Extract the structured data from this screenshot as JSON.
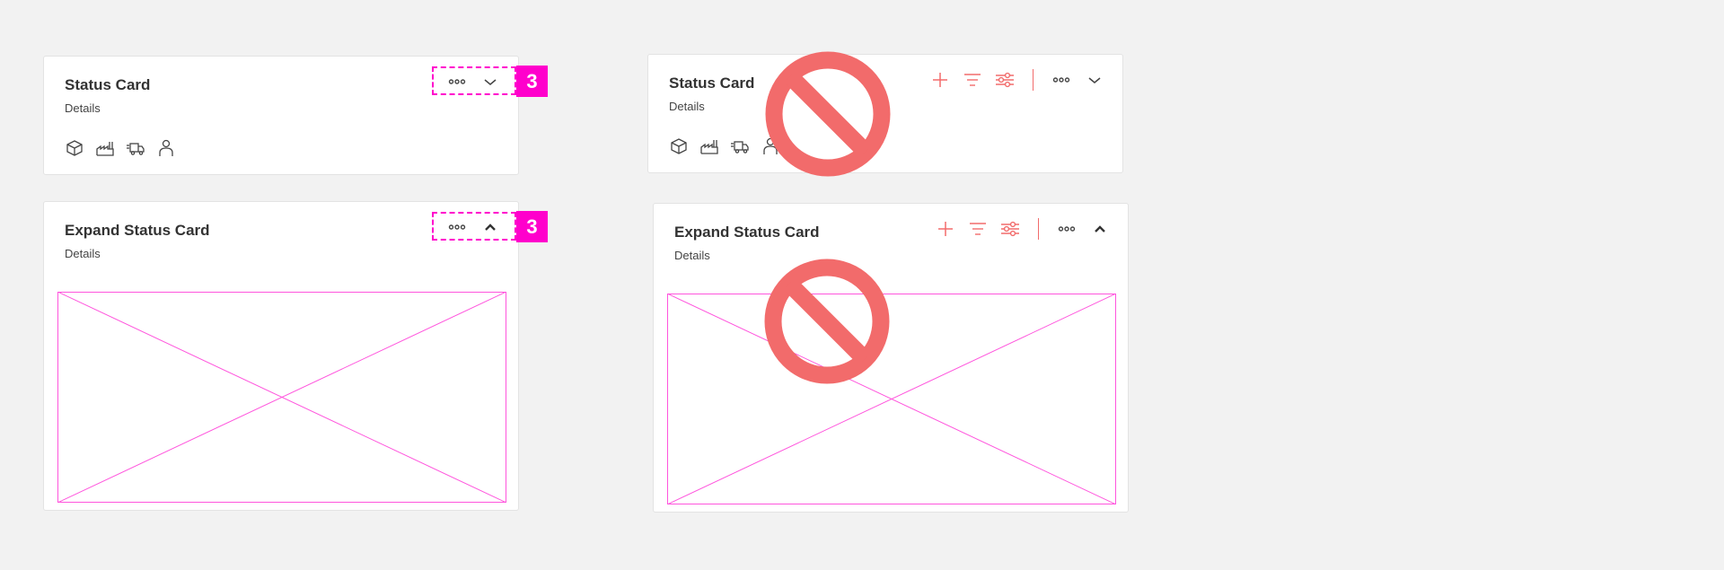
{
  "colors": {
    "background": "#f2f2f2",
    "card": "#ffffff",
    "annotation": "#ff00cc",
    "forbidden": "#f26b6b",
    "icon": "#444444"
  },
  "left_collapsed": {
    "title": "Status Card",
    "subtitle": "Details",
    "badge": "3",
    "actions": [
      "more-icon",
      "chevron-down-icon"
    ],
    "status_icons": [
      "box-icon",
      "factory-icon",
      "truck-icon",
      "person-icon"
    ]
  },
  "left_expanded": {
    "title": "Expand Status Card",
    "subtitle": "Details",
    "badge": "3",
    "actions": [
      "more-icon",
      "chevron-up-icon"
    ]
  },
  "right_collapsed": {
    "title": "Status Card",
    "subtitle": "Details",
    "tools": [
      "plus-icon",
      "filter-icon",
      "settings-sliders-icon"
    ],
    "actions": [
      "more-icon",
      "chevron-down-icon"
    ],
    "status_icons": [
      "box-icon",
      "factory-icon",
      "truck-icon",
      "person-icon"
    ],
    "overlay": "forbidden-icon"
  },
  "right_expanded": {
    "title": "Expand Status Card",
    "subtitle": "Details",
    "tools": [
      "plus-icon",
      "filter-icon",
      "settings-sliders-icon"
    ],
    "actions": [
      "more-icon",
      "chevron-up-icon"
    ],
    "overlay": "forbidden-icon"
  }
}
